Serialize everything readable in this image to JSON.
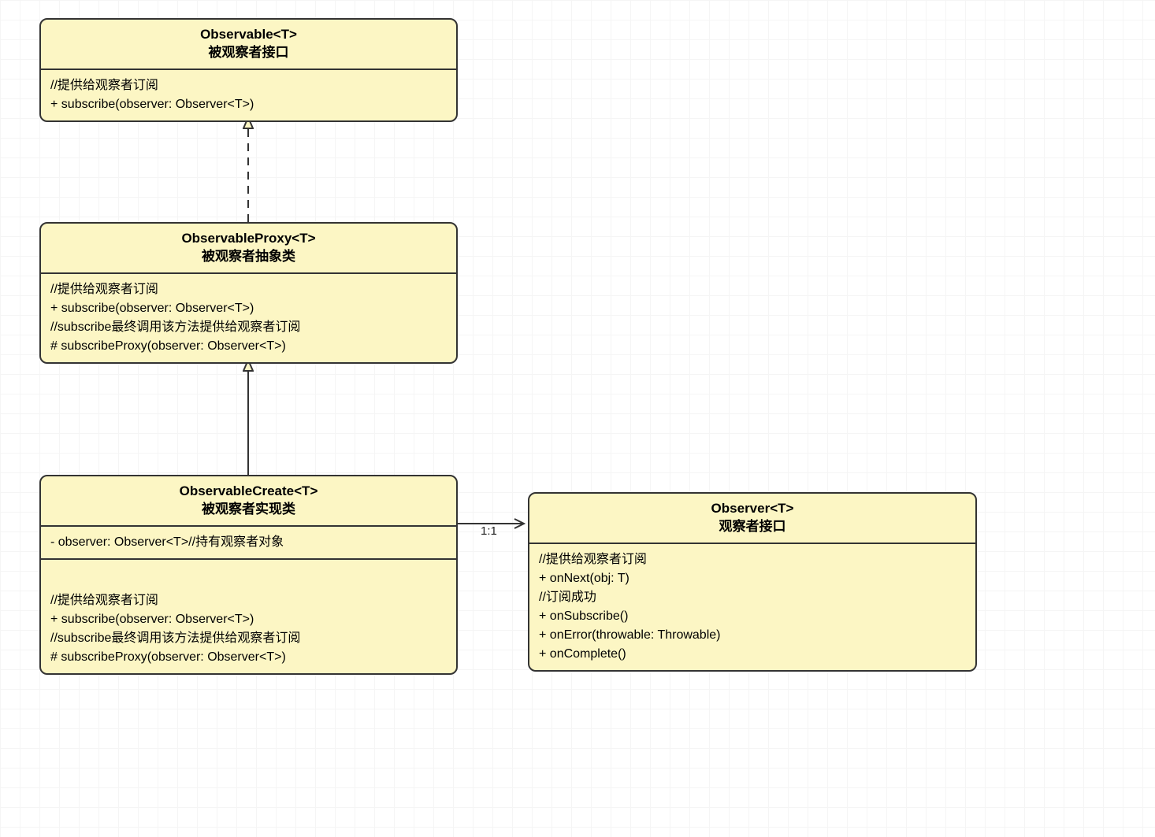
{
  "boxes": {
    "observable": {
      "title": "Observable<T>",
      "subtitle": "被观察者接口",
      "section1": {
        "l1": "//提供给观察者订阅",
        "l2": "+ subscribe(observer: Observer<T>)"
      }
    },
    "observableProxy": {
      "title": "ObservableProxy<T>",
      "subtitle": "被观察者抽象类",
      "section1": {
        "l1": "//提供给观察者订阅",
        "l2": "+ subscribe(observer: Observer<T>)",
        "l3": "//subscribe最终调用该方法提供给观察者订阅",
        "l4": "# subscribeProxy(observer: Observer<T>)"
      }
    },
    "observableCreate": {
      "title": "ObservableCreate<T>",
      "subtitle": "被观察者实现类",
      "section1": {
        "l1": "- observer: Observer<T>//持有观察者对象"
      },
      "section2": {
        "l1": "//提供给观察者订阅",
        "l2": "+ subscribe(observer: Observer<T>)",
        "l3": "//subscribe最终调用该方法提供给观察者订阅",
        "l4": "# subscribeProxy(observer: Observer<T>)"
      }
    },
    "observer": {
      "title": "Observer<T>",
      "subtitle": "观察者接口",
      "section1": {
        "l1": "//提供给观察者订阅",
        "l2": "+ onNext(obj: T)",
        "l3": "//订阅成功",
        "l4": "+ onSubscribe()",
        "l5": "+ onError(throwable: Throwable)",
        "l6": "+ onComplete()"
      }
    }
  },
  "association": {
    "label": "1:1"
  },
  "chart_data": {
    "type": "uml-class-diagram",
    "classes": [
      {
        "name": "Observable<T>",
        "stereotype_label": "被观察者接口",
        "kind": "interface",
        "members": [
          {
            "comment": "//提供给观察者订阅"
          },
          {
            "visibility": "+",
            "signature": "subscribe(observer: Observer<T>)"
          }
        ]
      },
      {
        "name": "ObservableProxy<T>",
        "stereotype_label": "被观察者抽象类",
        "kind": "abstract-class",
        "members": [
          {
            "comment": "//提供给观察者订阅"
          },
          {
            "visibility": "+",
            "signature": "subscribe(observer: Observer<T>)"
          },
          {
            "comment": "//subscribe最终调用该方法提供给观察者订阅"
          },
          {
            "visibility": "#",
            "signature": "subscribeProxy(observer: Observer<T>)"
          }
        ]
      },
      {
        "name": "ObservableCreate<T>",
        "stereotype_label": "被观察者实现类",
        "kind": "class",
        "attributes": [
          {
            "visibility": "-",
            "signature": "observer: Observer<T>",
            "comment": "//持有观察者对象"
          }
        ],
        "members": [
          {
            "comment": "//提供给观察者订阅"
          },
          {
            "visibility": "+",
            "signature": "subscribe(observer: Observer<T>)"
          },
          {
            "comment": "//subscribe最终调用该方法提供给观察者订阅"
          },
          {
            "visibility": "#",
            "signature": "subscribeProxy(observer: Observer<T>)"
          }
        ]
      },
      {
        "name": "Observer<T>",
        "stereotype_label": "观察者接口",
        "kind": "interface",
        "members": [
          {
            "comment": "//提供给观察者订阅"
          },
          {
            "visibility": "+",
            "signature": "onNext(obj: T)"
          },
          {
            "comment": "//订阅成功"
          },
          {
            "visibility": "+",
            "signature": "onSubscribe()"
          },
          {
            "visibility": "+",
            "signature": "onError(throwable: Throwable)"
          },
          {
            "visibility": "+",
            "signature": "onComplete()"
          }
        ]
      }
    ],
    "relations": [
      {
        "from": "ObservableProxy<T>",
        "to": "Observable<T>",
        "type": "realization",
        "line": "dashed",
        "arrow": "hollow-triangle"
      },
      {
        "from": "ObservableCreate<T>",
        "to": "ObservableProxy<T>",
        "type": "generalization",
        "line": "solid",
        "arrow": "hollow-triangle"
      },
      {
        "from": "ObservableCreate<T>",
        "to": "Observer<T>",
        "type": "association",
        "line": "solid",
        "arrow": "open",
        "label": "1:1"
      }
    ]
  }
}
